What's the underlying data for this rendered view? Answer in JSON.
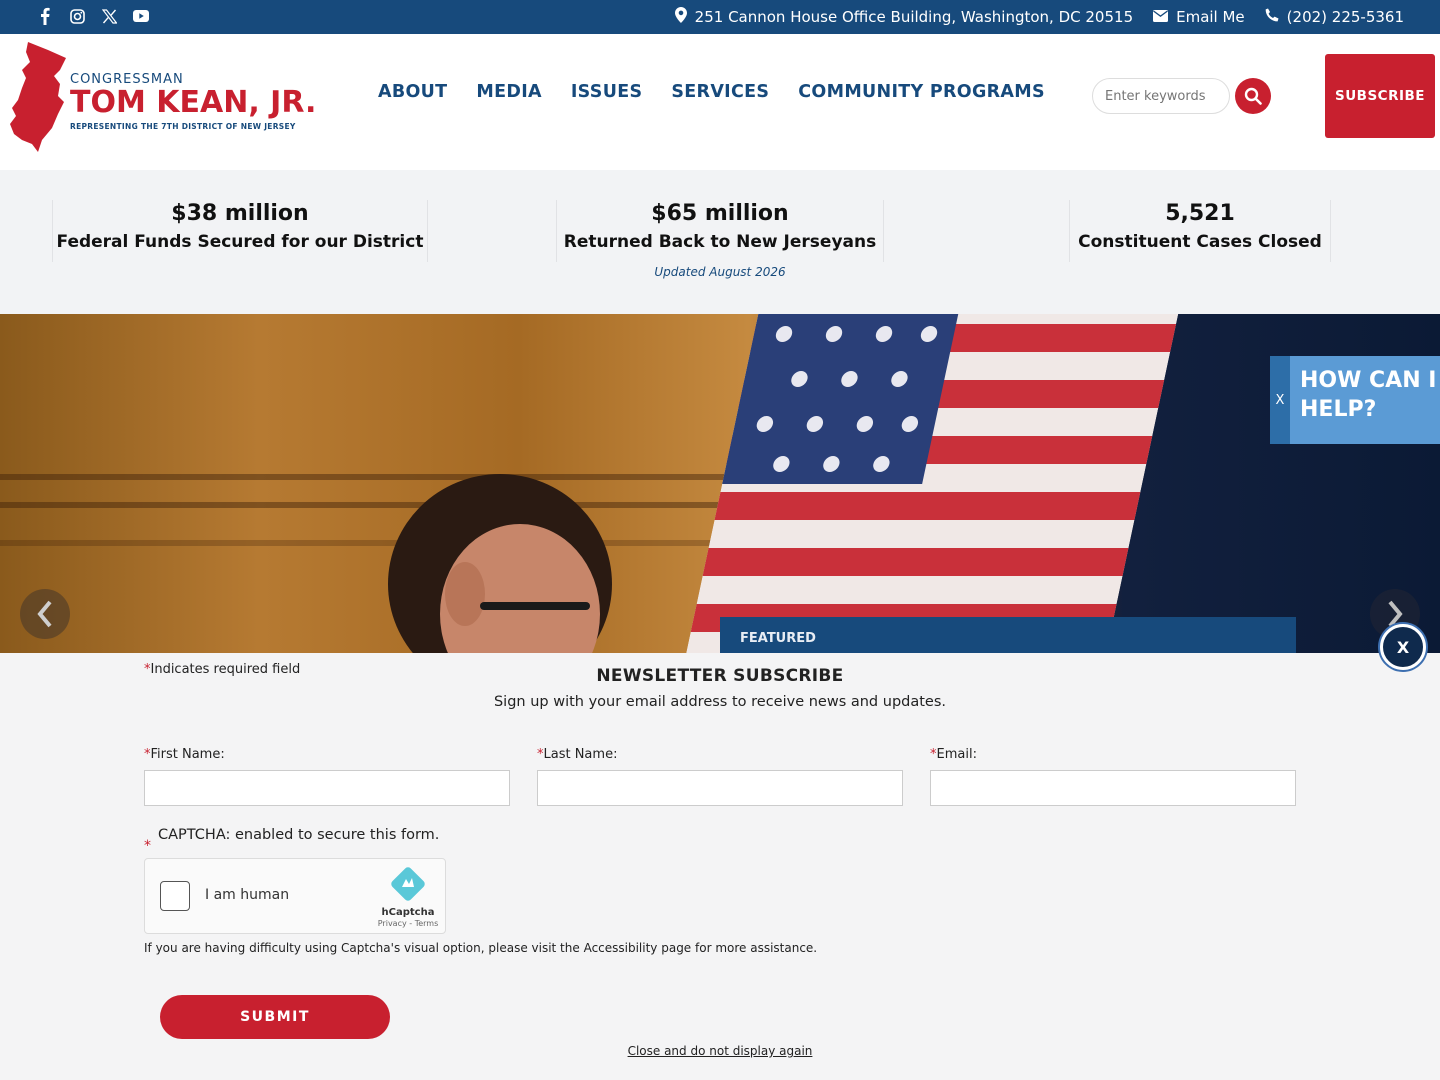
{
  "colors": {
    "navy": "#174a7c",
    "red": "#c8202f",
    "panel": "#f2f3f5"
  },
  "topbar": {
    "social_icons": [
      "facebook-icon",
      "instagram-icon",
      "x-icon",
      "youtube-icon"
    ],
    "address": "251 Cannon House Office Building, Washington, DC 20515",
    "email_label": "Email Me",
    "phone": "(202) 225-5361"
  },
  "logo": {
    "pre": "CONGRESSMAN",
    "name": "TOM KEAN, JR.",
    "tagline": "REPRESENTING THE 7TH DISTRICT OF NEW JERSEY"
  },
  "nav": {
    "items": [
      "ABOUT",
      "MEDIA",
      "ISSUES",
      "SERVICES",
      "COMMUNITY PROGRAMS"
    ]
  },
  "search": {
    "placeholder": "Enter keywords"
  },
  "header": {
    "subscribe_label": "SUBSCRIBE"
  },
  "stats": {
    "items": [
      {
        "value": "$38 million",
        "label": "Federal Funds Secured for our District"
      },
      {
        "value": "$65 million",
        "label": "Returned Back to New Jerseyans"
      },
      {
        "value": "5,521",
        "label": "Constituent Cases Closed"
      }
    ],
    "updated": "Updated August 2026"
  },
  "hero": {
    "featured_label": "FEATURED"
  },
  "help_widget": {
    "close": "X",
    "title_line1": "HOW CAN I",
    "title_line2": "HELP?"
  },
  "newsletter": {
    "close": "X",
    "required_note": "Indicates required field",
    "title": "NEWSLETTER SUBSCRIBE",
    "subtitle": "Sign up with your email address to receive news and updates.",
    "fields": [
      {
        "label": "First Name:",
        "value": ""
      },
      {
        "label": "Last Name:",
        "value": ""
      },
      {
        "label": "Email:",
        "value": ""
      }
    ],
    "captcha_label": "CAPTCHA: enabled to secure this form.",
    "captcha_human": "I am human",
    "captcha_brand": "hCaptcha",
    "captcha_terms": "Privacy - Terms",
    "captcha_help": "If you are having difficulty using Captcha's visual option, please visit the Accessibility page for more assistance.",
    "submit_label": "SUBMIT",
    "close_link": "Close and do not display again"
  }
}
